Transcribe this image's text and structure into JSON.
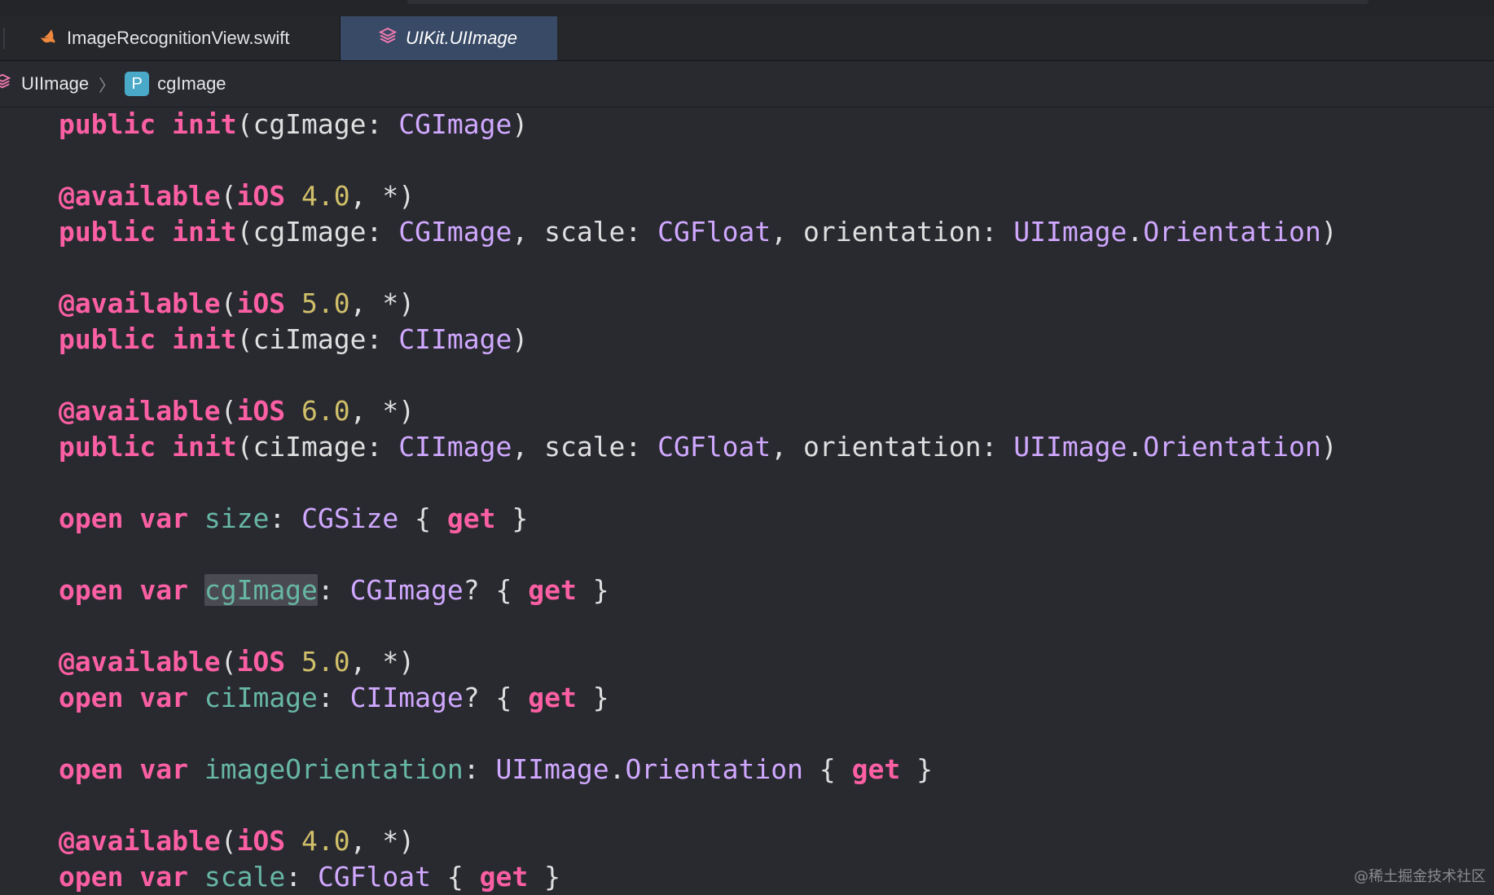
{
  "tabs": [
    {
      "label": "ImageRecognitionView.swift",
      "icon": "swift-icon",
      "active": false
    },
    {
      "label": "UIKit.UIImage",
      "icon": "module-cube-icon",
      "active": true
    }
  ],
  "breadcrumb": {
    "items": [
      {
        "label": "UIImage",
        "icon": "module-cube-icon"
      },
      {
        "label": "cgImage",
        "badge": "P"
      }
    ],
    "separator": "〉"
  },
  "code_lines": [
    [
      {
        "t": "public",
        "c": "kw"
      },
      {
        "t": " "
      },
      {
        "t": "init",
        "c": "kw"
      },
      {
        "t": "(cgImage: "
      },
      {
        "t": "CGImage",
        "c": "ty"
      },
      {
        "t": ")"
      }
    ],
    [],
    [
      {
        "t": "@available",
        "c": "attr"
      },
      {
        "t": "("
      },
      {
        "t": "iOS",
        "c": "attr"
      },
      {
        "t": " "
      },
      {
        "t": "4.0",
        "c": "num"
      },
      {
        "t": ", *)"
      }
    ],
    [
      {
        "t": "public",
        "c": "kw"
      },
      {
        "t": " "
      },
      {
        "t": "init",
        "c": "kw"
      },
      {
        "t": "(cgImage: "
      },
      {
        "t": "CGImage",
        "c": "ty"
      },
      {
        "t": ", scale: "
      },
      {
        "t": "CGFloat",
        "c": "ty"
      },
      {
        "t": ", orientation: "
      },
      {
        "t": "UIImage",
        "c": "ty"
      },
      {
        "t": "."
      },
      {
        "t": "Orientation",
        "c": "ty"
      },
      {
        "t": ")"
      }
    ],
    [],
    [
      {
        "t": "@available",
        "c": "attr"
      },
      {
        "t": "("
      },
      {
        "t": "iOS",
        "c": "attr"
      },
      {
        "t": " "
      },
      {
        "t": "5.0",
        "c": "num"
      },
      {
        "t": ", *)"
      }
    ],
    [
      {
        "t": "public",
        "c": "kw"
      },
      {
        "t": " "
      },
      {
        "t": "init",
        "c": "kw"
      },
      {
        "t": "(ciImage: "
      },
      {
        "t": "CIImage",
        "c": "ty"
      },
      {
        "t": ")"
      }
    ],
    [],
    [
      {
        "t": "@available",
        "c": "attr"
      },
      {
        "t": "("
      },
      {
        "t": "iOS",
        "c": "attr"
      },
      {
        "t": " "
      },
      {
        "t": "6.0",
        "c": "num"
      },
      {
        "t": ", *)"
      }
    ],
    [
      {
        "t": "public",
        "c": "kw"
      },
      {
        "t": " "
      },
      {
        "t": "init",
        "c": "kw"
      },
      {
        "t": "(ciImage: "
      },
      {
        "t": "CIImage",
        "c": "ty"
      },
      {
        "t": ", scale: "
      },
      {
        "t": "CGFloat",
        "c": "ty"
      },
      {
        "t": ", orientation: "
      },
      {
        "t": "UIImage",
        "c": "ty"
      },
      {
        "t": "."
      },
      {
        "t": "Orientation",
        "c": "ty"
      },
      {
        "t": ")"
      }
    ],
    [],
    [
      {
        "t": "open",
        "c": "kw"
      },
      {
        "t": " "
      },
      {
        "t": "var",
        "c": "kw"
      },
      {
        "t": " "
      },
      {
        "t": "size",
        "c": "prop"
      },
      {
        "t": ": "
      },
      {
        "t": "CGSize",
        "c": "ty"
      },
      {
        "t": " { "
      },
      {
        "t": "get",
        "c": "kw"
      },
      {
        "t": " }"
      }
    ],
    [],
    [
      {
        "t": "open",
        "c": "kw"
      },
      {
        "t": " "
      },
      {
        "t": "var",
        "c": "kw"
      },
      {
        "t": " "
      },
      {
        "t": "cgImage",
        "c": "prop",
        "hl": true
      },
      {
        "t": ": "
      },
      {
        "t": "CGImage",
        "c": "ty"
      },
      {
        "t": "? { "
      },
      {
        "t": "get",
        "c": "kw"
      },
      {
        "t": " }"
      }
    ],
    [],
    [
      {
        "t": "@available",
        "c": "attr"
      },
      {
        "t": "("
      },
      {
        "t": "iOS",
        "c": "attr"
      },
      {
        "t": " "
      },
      {
        "t": "5.0",
        "c": "num"
      },
      {
        "t": ", *)"
      }
    ],
    [
      {
        "t": "open",
        "c": "kw"
      },
      {
        "t": " "
      },
      {
        "t": "var",
        "c": "kw"
      },
      {
        "t": " "
      },
      {
        "t": "ciImage",
        "c": "prop"
      },
      {
        "t": ": "
      },
      {
        "t": "CIImage",
        "c": "ty"
      },
      {
        "t": "? { "
      },
      {
        "t": "get",
        "c": "kw"
      },
      {
        "t": " }"
      }
    ],
    [],
    [
      {
        "t": "open",
        "c": "kw"
      },
      {
        "t": " "
      },
      {
        "t": "var",
        "c": "kw"
      },
      {
        "t": " "
      },
      {
        "t": "imageOrientation",
        "c": "prop"
      },
      {
        "t": ": "
      },
      {
        "t": "UIImage",
        "c": "ty"
      },
      {
        "t": "."
      },
      {
        "t": "Orientation",
        "c": "ty"
      },
      {
        "t": " { "
      },
      {
        "t": "get",
        "c": "kw"
      },
      {
        "t": " }"
      }
    ],
    [],
    [
      {
        "t": "@available",
        "c": "attr"
      },
      {
        "t": "("
      },
      {
        "t": "iOS",
        "c": "attr"
      },
      {
        "t": " "
      },
      {
        "t": "4.0",
        "c": "num"
      },
      {
        "t": ", *)"
      }
    ],
    [
      {
        "t": "open",
        "c": "kw"
      },
      {
        "t": " "
      },
      {
        "t": "var",
        "c": "kw"
      },
      {
        "t": " "
      },
      {
        "t": "scale",
        "c": "prop"
      },
      {
        "t": ": "
      },
      {
        "t": "CGFloat",
        "c": "ty"
      },
      {
        "t": " { "
      },
      {
        "t": "get",
        "c": "kw"
      },
      {
        "t": " }"
      }
    ]
  ],
  "watermark": "@稀土掘金技术社区",
  "colors": {
    "background": "#292a30",
    "keyword": "#fc5fa3",
    "type": "#d0a8ff",
    "number": "#d0bf69",
    "property": "#67b7a4",
    "active_tab": "#384a66"
  }
}
